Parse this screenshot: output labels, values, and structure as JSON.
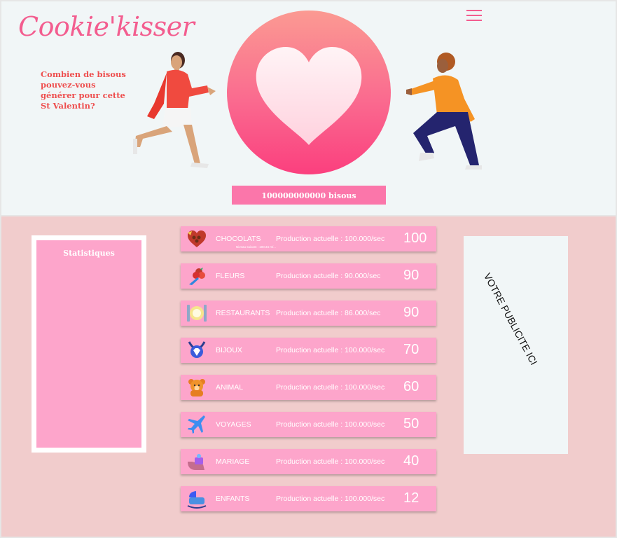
{
  "app": {
    "logo": "Cookie'kisser",
    "tagline": "Combien de bisous pouvez-vous générer pour cette St Valentin?",
    "counter": "100000000000 bisous"
  },
  "stats": {
    "title": "Statistiques"
  },
  "items": [
    {
      "name": "CHOCOLATS",
      "production": "Production actuelle : 100.000/sec",
      "count": "100",
      "sub": "Niveau suivant : 100.34 m/...",
      "icon": "chocolate-box-icon"
    },
    {
      "name": "FLEURS",
      "production": "Production actuelle : 90.000/sec",
      "count": "90",
      "icon": "flower-bouquet-icon"
    },
    {
      "name": "RESTAURANTS",
      "production": "Production actuelle : 86.000/sec",
      "count": "90",
      "icon": "restaurant-plate-icon"
    },
    {
      "name": "BIJOUX",
      "production": "Production actuelle : 100.000/sec",
      "count": "70",
      "icon": "necklace-icon"
    },
    {
      "name": "ANIMAL",
      "production": "Production actuelle : 100.000/sec",
      "count": "60",
      "icon": "teddy-bear-icon"
    },
    {
      "name": "VOYAGES",
      "production": "Production actuelle : 100.000/sec",
      "count": "50",
      "icon": "airplane-icon"
    },
    {
      "name": "MARIAGE",
      "production": "Production actuelle : 100.000/sec",
      "count": "40",
      "icon": "wedding-ring-icon"
    },
    {
      "name": "ENFANTS",
      "production": "Production actuelle : 100.000/sec",
      "count": "12",
      "icon": "baby-cradle-icon"
    }
  ],
  "ad": {
    "text": "VOTRE PUBLICITE ICI"
  },
  "colors": {
    "accent": "#f35d8f",
    "panel": "#fda5cb",
    "counter": "#fb76aa",
    "bottom_bg": "#f1cccc",
    "top_bg": "#f1f6f7"
  }
}
